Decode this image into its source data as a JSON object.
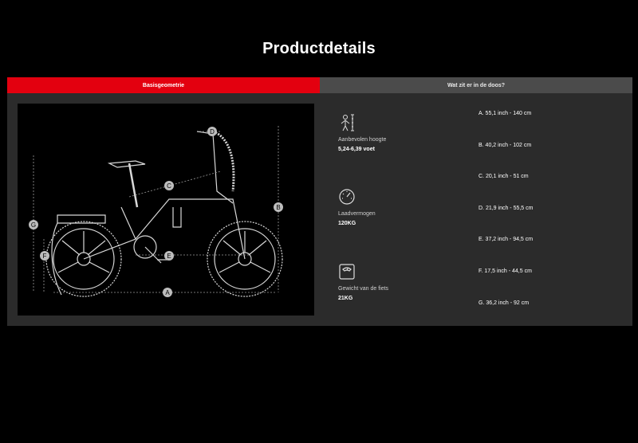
{
  "page": {
    "title": "Productdetails"
  },
  "tabs": [
    {
      "label": "Basisgeometrie",
      "active": true
    },
    {
      "label": "Wat zit er in de doos?",
      "active": false
    }
  ],
  "colors": {
    "accent": "#e3000f",
    "panel": "#2b2b2b",
    "tab_inactive": "#4b4b4b"
  },
  "diagram": {
    "markers": [
      "A",
      "B",
      "C",
      "D",
      "E",
      "F",
      "G"
    ]
  },
  "specs": [
    {
      "icon": "person-height-icon",
      "label": "Aanbevolen hoogte",
      "value": "5,24-6,39 voet"
    },
    {
      "icon": "speedometer-icon",
      "label": "Laadvermogen",
      "value": "120KG"
    },
    {
      "icon": "scale-icon",
      "label": "Gewicht van de fiets",
      "value": "21KG"
    }
  ],
  "dimensions": [
    "A. 55,1 inch - 140 cm",
    "B. 40,2 inch - 102 cm",
    "C. 20,1 inch - 51 cm",
    "D. 21,9 inch - 55,5 cm",
    "E. 37,2 inch - 94,5 cm",
    "F. 17,5 inch - 44,5 cm",
    "G. 36,2 inch - 92 cm"
  ]
}
